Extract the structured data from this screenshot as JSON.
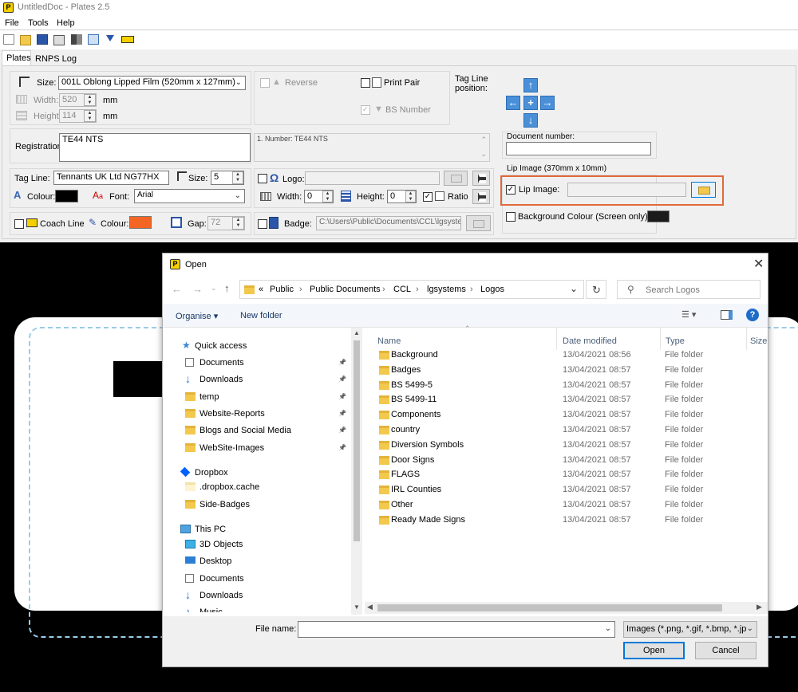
{
  "app": {
    "title": "UntitledDoc - Plates 2.5",
    "menu": [
      "File",
      "Tools",
      "Help"
    ],
    "tabs": [
      "Plates",
      "RNPS Log"
    ]
  },
  "plates": {
    "size_label": "Size:",
    "size_value": "001L Oblong Lipped Film (520mm x 127mm)",
    "width_label": "Width:",
    "width_value": "520",
    "height_label": "Height:",
    "height_value": "114",
    "unit": "mm",
    "reverse_label": "Reverse",
    "print_pair_label": "Print Pair",
    "bs_number_label": "BS Number",
    "tag_line_position_label": "Tag Line position:",
    "registration_label": "Registration:",
    "registration_value": "TE44 NTS",
    "number_preview": "1. Number: TE44 NTS",
    "document_number_label": "Document number:",
    "document_number_value": "",
    "tag_line_label": "Tag Line:",
    "tag_line_value": "Tennants UK Ltd NG77HX",
    "tag_size_label": "Size:",
    "tag_size_value": "5",
    "colour_label": "Colour:",
    "font_label": "Font:",
    "font_value": "Arial",
    "logo_label": "Logo:",
    "logo_width_label": "Width:",
    "logo_width_value": "0",
    "logo_height_label": "Height:",
    "logo_height_value": "0",
    "ratio_label": "Ratio",
    "lip_image_group": "Lip Image (370mm x 10mm)",
    "lip_image_label": "Lip Image:",
    "background_colour_label": "Background Colour (Screen only):",
    "coach_line_label": "Coach Line",
    "coach_colour_label": "Colour:",
    "gap_label": "Gap:",
    "gap_value": "72",
    "badge_label": "Badge:",
    "badge_value": "C:\\Users\\Public\\Documents\\CCL\\lgsyste"
  },
  "colors": {
    "tag_colour": "#000000",
    "coach_colour": "#f26522",
    "background_colour": "#1a1a1a",
    "highlight": "#e0693a",
    "accent": "#0067c0"
  },
  "dialog": {
    "title": "Open",
    "breadcrumb_prefix": "«",
    "breadcrumb": [
      "Public",
      "Public Documents",
      "CCL",
      "lgsystems",
      "Logos"
    ],
    "search_placeholder": "Search Logos",
    "organise_label": "Organise ▾",
    "new_folder_label": "New folder",
    "quick_access": "Quick access",
    "nav_quick": [
      "Documents",
      "Downloads",
      "temp",
      "Website-Reports",
      "Blogs and Social Media",
      "WebSite-Images"
    ],
    "dropbox": "Dropbox",
    "nav_dropbox": [
      ".dropbox.cache",
      "Side-Badges"
    ],
    "this_pc": "This PC",
    "nav_pc": [
      "3D Objects",
      "Desktop",
      "Documents",
      "Downloads",
      "Music"
    ],
    "columns": [
      "Name",
      "Date modified",
      "Type",
      "Size"
    ],
    "files": [
      {
        "name": "Background",
        "date": "13/04/2021 08:56",
        "type": "File folder"
      },
      {
        "name": "Badges",
        "date": "13/04/2021 08:57",
        "type": "File folder"
      },
      {
        "name": "BS 5499-5",
        "date": "13/04/2021 08:57",
        "type": "File folder"
      },
      {
        "name": "BS 5499-11",
        "date": "13/04/2021 08:57",
        "type": "File folder"
      },
      {
        "name": "Components",
        "date": "13/04/2021 08:57",
        "type": "File folder"
      },
      {
        "name": "country",
        "date": "13/04/2021 08:57",
        "type": "File folder"
      },
      {
        "name": "Diversion Symbols",
        "date": "13/04/2021 08:57",
        "type": "File folder"
      },
      {
        "name": "Door Signs",
        "date": "13/04/2021 08:57",
        "type": "File folder"
      },
      {
        "name": "FLAGS",
        "date": "13/04/2021 08:57",
        "type": "File folder"
      },
      {
        "name": "IRL Counties",
        "date": "13/04/2021 08:57",
        "type": "File folder"
      },
      {
        "name": "Other",
        "date": "13/04/2021 08:57",
        "type": "File folder"
      },
      {
        "name": "Ready Made Signs",
        "date": "13/04/2021 08:57",
        "type": "File folder"
      }
    ],
    "file_name_label": "File name:",
    "file_name_value": "",
    "filter_value": "Images (*.png, *.gif, *.bmp, *.jp",
    "open_button": "Open",
    "cancel_button": "Cancel"
  }
}
